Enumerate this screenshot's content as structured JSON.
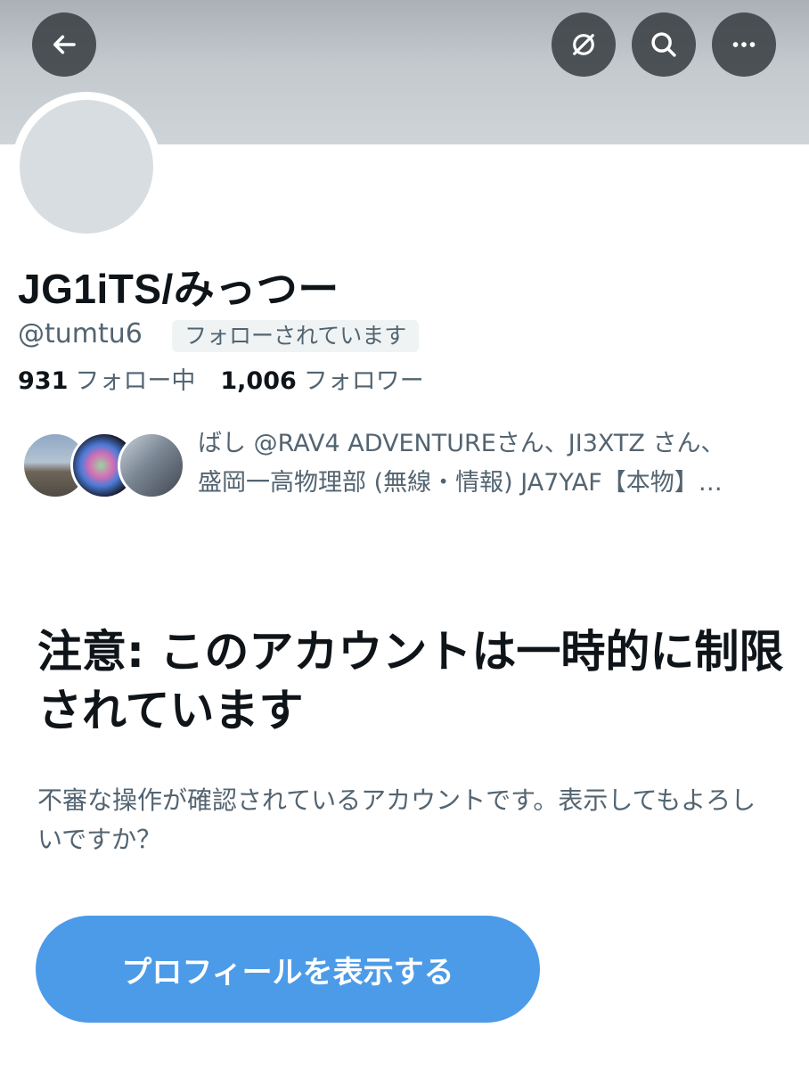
{
  "header": {
    "back_icon": "arrow-left-icon",
    "mute_icon": "notification-off-icon",
    "search_icon": "search-icon",
    "more_icon": "more-horizontal-icon"
  },
  "profile": {
    "display_name": "JG1iTS/みっつー",
    "handle": "@tumtu6",
    "follows_you_badge": "フォローされています",
    "following_count": "931",
    "following_label": "フォロー中",
    "followers_count": "1,006",
    "followers_label": "フォロワー"
  },
  "followers_you_know": {
    "line1": "ばし @RAV4 ADVENTUREさん、JI3XTZ さん、",
    "line2": "盛岡一高物理部 (無線・情報) JA7YAF【本物】…"
  },
  "warning": {
    "title": "注意: このアカウントは一時的に制限されています",
    "body": "不審な操作が確認されているアカウントです。表示してもよろしいですか？",
    "button_label": "プロフィールを表示する"
  },
  "colors": {
    "accent": "#4c9be8",
    "secondary_text": "#536471",
    "primary_text": "#0f1419"
  }
}
